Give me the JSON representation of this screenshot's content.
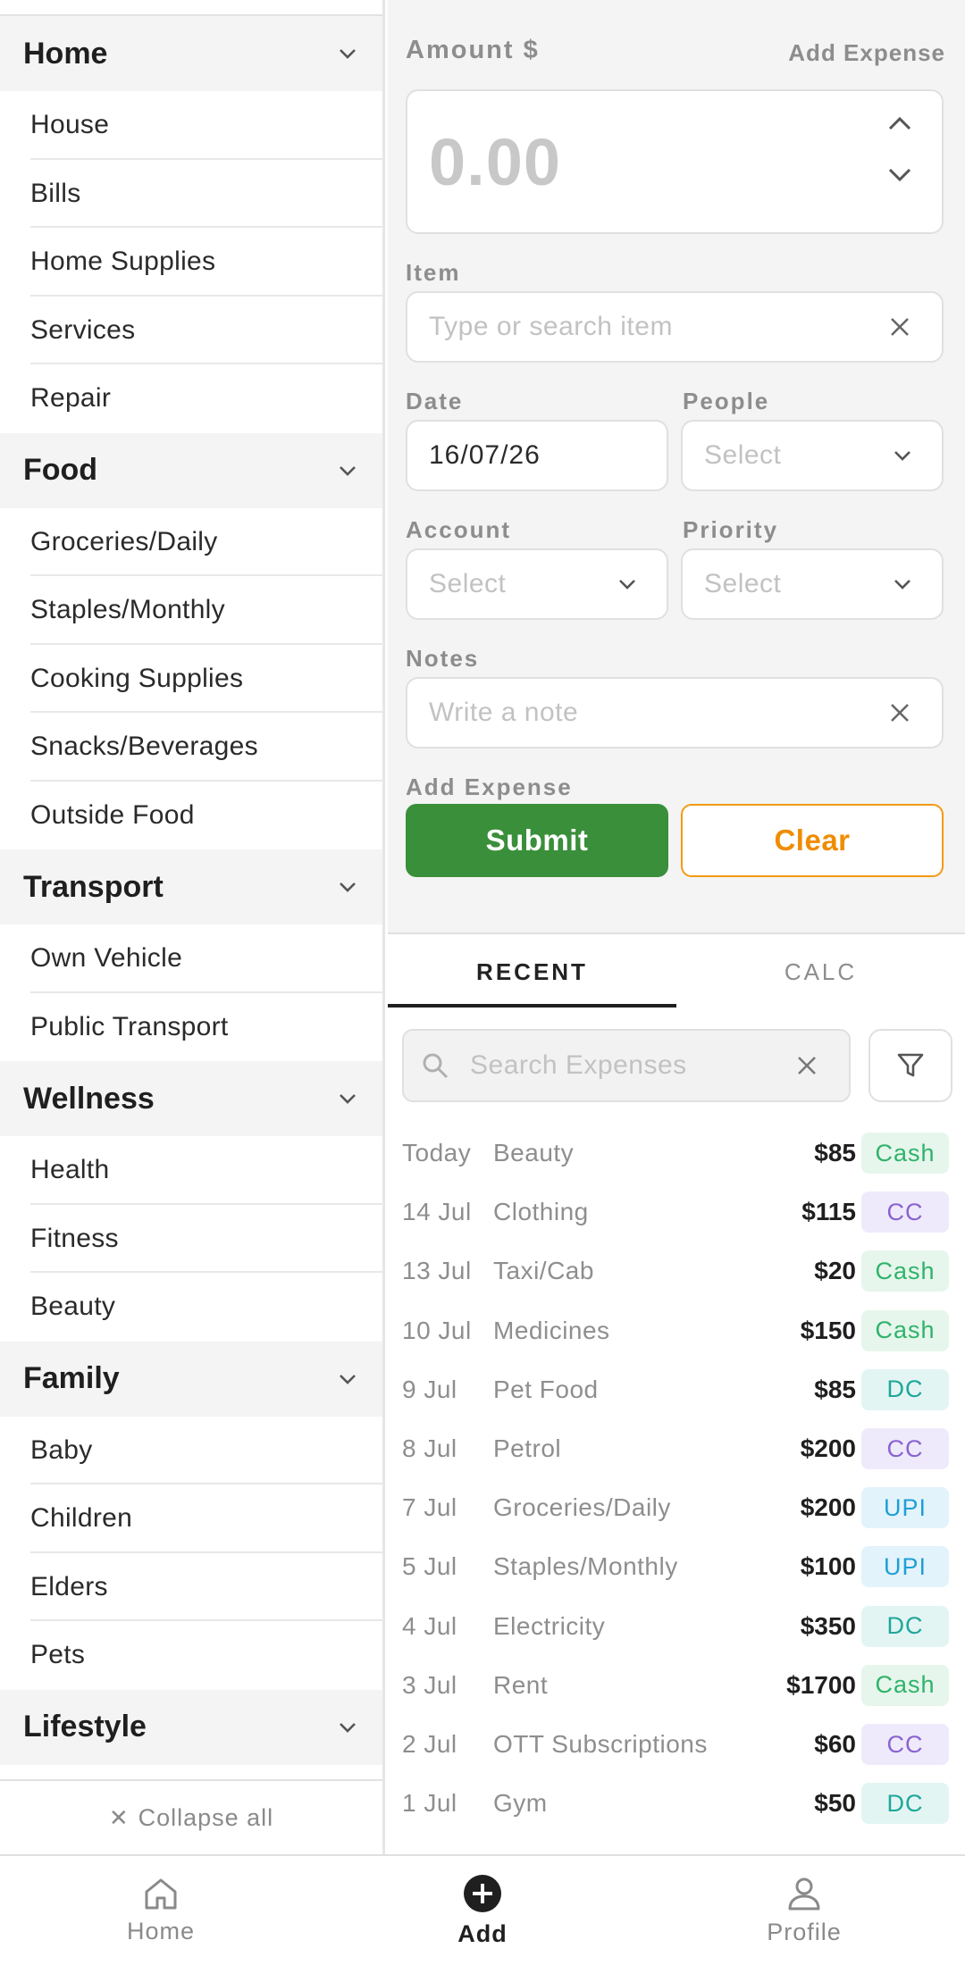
{
  "sidebar": {
    "categories": [
      {
        "title": "Home",
        "items": [
          "House",
          "Bills",
          "Home Supplies",
          "Services",
          "Repair"
        ]
      },
      {
        "title": "Food",
        "items": [
          "Groceries/Daily",
          "Staples/Monthly",
          "Cooking Supplies",
          "Snacks/Beverages",
          "Outside Food"
        ]
      },
      {
        "title": "Transport",
        "items": [
          "Own Vehicle",
          "Public Transport"
        ]
      },
      {
        "title": "Wellness",
        "items": [
          "Health",
          "Fitness",
          "Beauty"
        ]
      },
      {
        "title": "Family",
        "items": [
          "Baby",
          "Children",
          "Elders",
          "Pets"
        ]
      },
      {
        "title": "Lifestyle",
        "items": []
      }
    ],
    "collapse_all_label": "Collapse all",
    "collapse_icon": "close-icon"
  },
  "form": {
    "amount_label": "Amount $",
    "header_title": "Add Expense",
    "amount_placeholder": "0.00",
    "item_label": "Item",
    "item_placeholder": "Type or search item",
    "date_label": "Date",
    "date_value": "16/07/26",
    "people_label": "People",
    "people_placeholder": "Select",
    "account_label": "Account",
    "account_placeholder": "Select",
    "priority_label": "Priority",
    "priority_placeholder": "Select",
    "notes_label": "Notes",
    "notes_placeholder": "Write a note",
    "actions_label": "Add Expense",
    "submit_label": "Submit",
    "clear_label": "Clear",
    "submit_color": "#3a8f3a",
    "clear_color": "#f08c00"
  },
  "tabs": [
    {
      "label": "RECENT",
      "active": true
    },
    {
      "label": "CALC",
      "active": false
    }
  ],
  "search": {
    "placeholder": "Search Expenses"
  },
  "expenses": [
    {
      "date": "Today",
      "item": "Beauty",
      "amount": "$85",
      "method": "Cash"
    },
    {
      "date": "14 Jul",
      "item": "Clothing",
      "amount": "$115",
      "method": "CC"
    },
    {
      "date": "13 Jul",
      "item": "Taxi/Cab",
      "amount": "$20",
      "method": "Cash"
    },
    {
      "date": "10 Jul",
      "item": "Medicines",
      "amount": "$150",
      "method": "Cash"
    },
    {
      "date": "9 Jul",
      "item": "Pet Food",
      "amount": "$85",
      "method": "DC"
    },
    {
      "date": "8 Jul",
      "item": "Petrol",
      "amount": "$200",
      "method": "CC"
    },
    {
      "date": "7 Jul",
      "item": "Groceries/Daily",
      "amount": "$200",
      "method": "UPI"
    },
    {
      "date": "5 Jul",
      "item": "Staples/Monthly",
      "amount": "$100",
      "method": "UPI"
    },
    {
      "date": "4 Jul",
      "item": "Electricity",
      "amount": "$350",
      "method": "DC"
    },
    {
      "date": "3 Jul",
      "item": "Rent",
      "amount": "$1700",
      "method": "Cash"
    },
    {
      "date": "2 Jul",
      "item": "OTT Subscriptions",
      "amount": "$60",
      "method": "CC"
    },
    {
      "date": "1 Jul",
      "item": "Gym",
      "amount": "$50",
      "method": "DC"
    }
  ],
  "method_colors": {
    "Cash": {
      "text": "#2fb36a",
      "bg": "#e6f6ec"
    },
    "CC": {
      "text": "#8a63d2",
      "bg": "#efeafb"
    },
    "DC": {
      "text": "#1fa79a",
      "bg": "#e3f5f3"
    },
    "UPI": {
      "text": "#1e9fd6",
      "bg": "#e3f3fb"
    }
  },
  "bottom_nav": [
    {
      "label": "Home",
      "icon": "home-icon",
      "active": false
    },
    {
      "label": "Add",
      "icon": "add-circle-icon",
      "active": true
    },
    {
      "label": "Profile",
      "icon": "person-icon",
      "active": false
    }
  ]
}
